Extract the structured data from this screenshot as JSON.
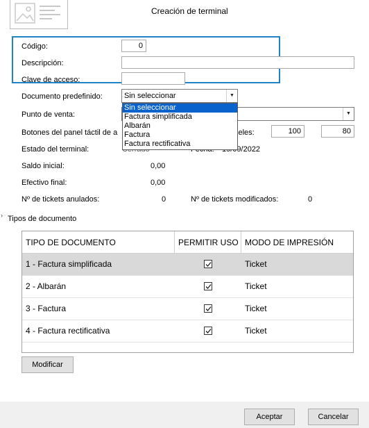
{
  "window": {
    "title": "Creación de terminal"
  },
  "form": {
    "codigo_label": "Código:",
    "codigo_value": "0",
    "descripcion_label": "Descripción:",
    "descripcion_value": "",
    "clave_label": "Clave de acceso:",
    "clave_value": "",
    "documento_label": "Documento predefinido:",
    "documento_selected": "Sin seleccionar",
    "documento_options": [
      "Sin seleccionar",
      "Factura simplificada",
      "Albarán",
      "Factura",
      "Factura rectificativa"
    ],
    "punto_venta_label": "Punto de venta:",
    "botones_label_visible": "Botones del panel táctil de a",
    "pixeles_label_visible": "xeles:",
    "pixeles_w": "100",
    "pixeles_h": "80",
    "estado_label": "Estado del terminal:",
    "estado_value_partial": "Cerrado",
    "fecha_label_partial": "Fecha:",
    "fecha_value_partial": "19/09/2022",
    "saldo_label": "Saldo inicial:",
    "saldo_value": "0,00",
    "efectivo_label": "Efectivo final:",
    "efectivo_value": "0,00",
    "anulados_label": "Nº de tickets anulados:",
    "anulados_value": "0",
    "modificados_label": "Nº de tickets modificados:",
    "modificados_value": "0"
  },
  "tipos": {
    "section_label": "Tipos de documento",
    "columns": [
      "TIPO DE DOCUMENTO",
      "PERMITIR USO",
      "MODO DE IMPRESIÓN"
    ],
    "rows": [
      {
        "tipo": "1 - Factura simplificada",
        "permitir": true,
        "modo": "Ticket"
      },
      {
        "tipo": "2 - Albarán",
        "permitir": true,
        "modo": "Ticket"
      },
      {
        "tipo": "3 - Factura",
        "permitir": true,
        "modo": "Ticket"
      },
      {
        "tipo": "4 - Factura rectificativa",
        "permitir": true,
        "modo": "Ticket"
      }
    ],
    "modificar_label": "Modificar"
  },
  "footer": {
    "aceptar_label": "Aceptar",
    "cancelar_label": "Cancelar"
  },
  "colors": {
    "accent_frame": "#1f83c5",
    "selection": "#0a63cc",
    "row_highlight": "#d9d9d9"
  }
}
